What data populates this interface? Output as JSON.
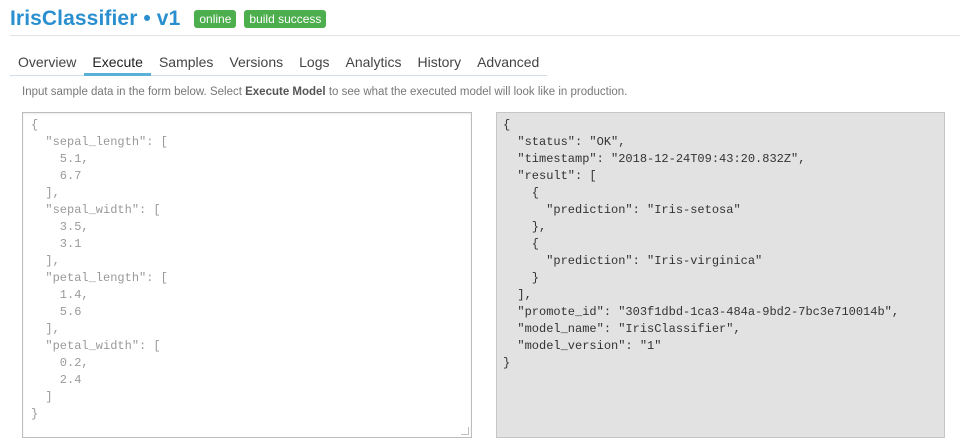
{
  "header": {
    "title": "IrisClassifier • v1",
    "badges": {
      "status": "online",
      "build": "build success"
    }
  },
  "tabs": [
    "Overview",
    "Execute",
    "Samples",
    "Versions",
    "Logs",
    "Analytics",
    "History",
    "Advanced"
  ],
  "active_tab": "Execute",
  "hint": {
    "prefix": "Input sample data in the form below. Select ",
    "bold": "Execute Model",
    "suffix": " to see what the executed model will look like in production."
  },
  "input_json": "{\n  \"sepal_length\": [\n    5.1,\n    6.7\n  ],\n  \"sepal_width\": [\n    3.5,\n    3.1\n  ],\n  \"petal_length\": [\n    1.4,\n    5.6\n  ],\n  \"petal_width\": [\n    0.2,\n    2.4\n  ]\n}",
  "output_json": "{\n  \"status\": \"OK\",\n  \"timestamp\": \"2018-12-24T09:43:20.832Z\",\n  \"result\": [\n    {\n      \"prediction\": \"Iris-setosa\"\n    },\n    {\n      \"prediction\": \"Iris-virginica\"\n    }\n  ],\n  \"promote_id\": \"303f1dbd-1ca3-484a-9bd2-7bc3e710014b\",\n  \"model_name\": \"IrisClassifier\",\n  \"model_version\": \"1\"\n}",
  "colors": {
    "title": "#2a8fcf",
    "badge": "#4cae4c",
    "tab_underline": "#5ab0d6",
    "output_bg": "#e2e2e2"
  }
}
